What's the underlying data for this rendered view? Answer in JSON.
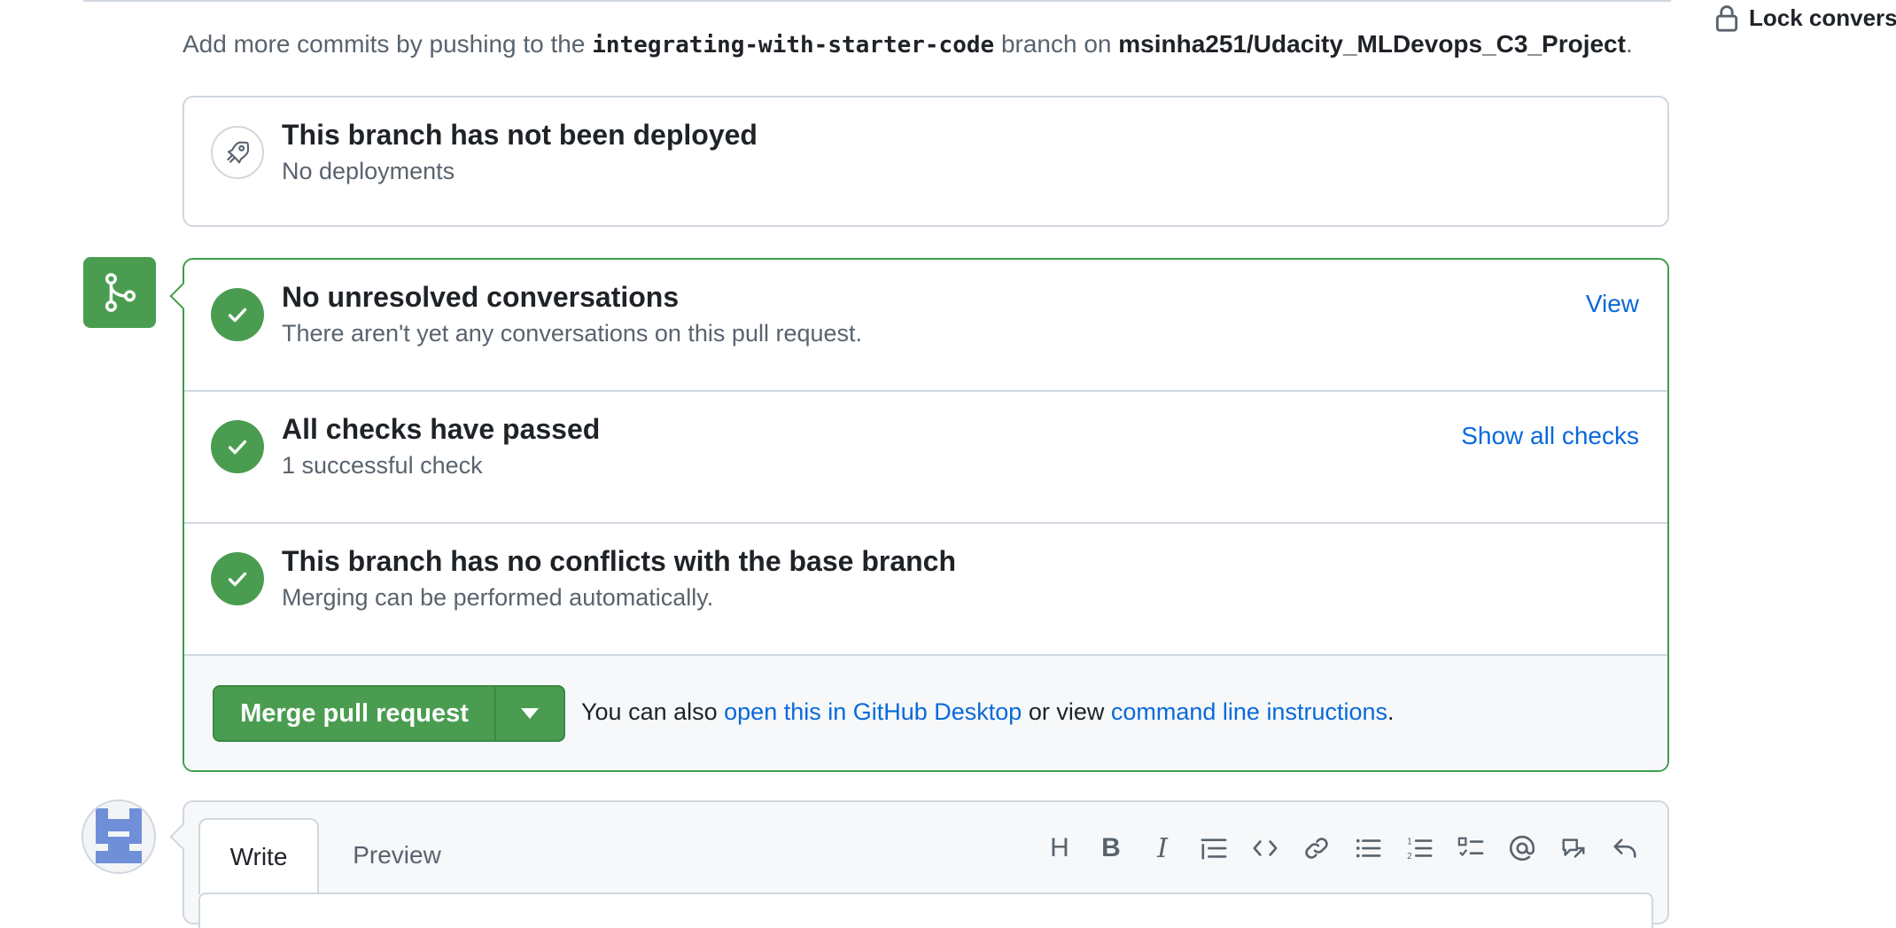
{
  "header": {
    "lock_label": "Lock conversa"
  },
  "info": {
    "prefix": "Add more commits by pushing to the ",
    "branch": "integrating-with-starter-code",
    "middle": " branch on ",
    "repo": "msinha251/Udacity_MLDevops_C3_Project",
    "suffix": "."
  },
  "deployment": {
    "icon": "rocket-icon",
    "title": "This branch has not been deployed",
    "subtitle": "No deployments"
  },
  "merge_rows": [
    {
      "icon": "check-icon",
      "title": "No unresolved conversations",
      "subtitle": "There aren't yet any conversations on this pull request.",
      "link": "View"
    },
    {
      "icon": "check-icon",
      "title": "All checks have passed",
      "subtitle": "1 successful check",
      "link": "Show all checks"
    },
    {
      "icon": "check-icon",
      "title": "This branch has no conflicts with the base branch",
      "subtitle": "Merging can be performed automatically."
    }
  ],
  "merge_footer": {
    "button_label": "Merge pull request",
    "also_prefix": "You can also ",
    "desktop_link": "open this in GitHub Desktop",
    "or_view": " or view ",
    "cli_link": "command line instructions",
    "suffix": "."
  },
  "comment": {
    "tabs": [
      "Write",
      "Preview"
    ],
    "toolbar": [
      "heading-icon",
      "bold-icon",
      "italic-icon",
      "quote-icon",
      "code-icon",
      "link-icon",
      "unordered-list-icon",
      "ordered-list-icon",
      "task-list-icon",
      "mention-icon",
      "cross-reference-icon",
      "reply-icon"
    ]
  },
  "colors": {
    "success": "#4a9d50",
    "link": "#0969da",
    "border": "#d0d7de"
  }
}
